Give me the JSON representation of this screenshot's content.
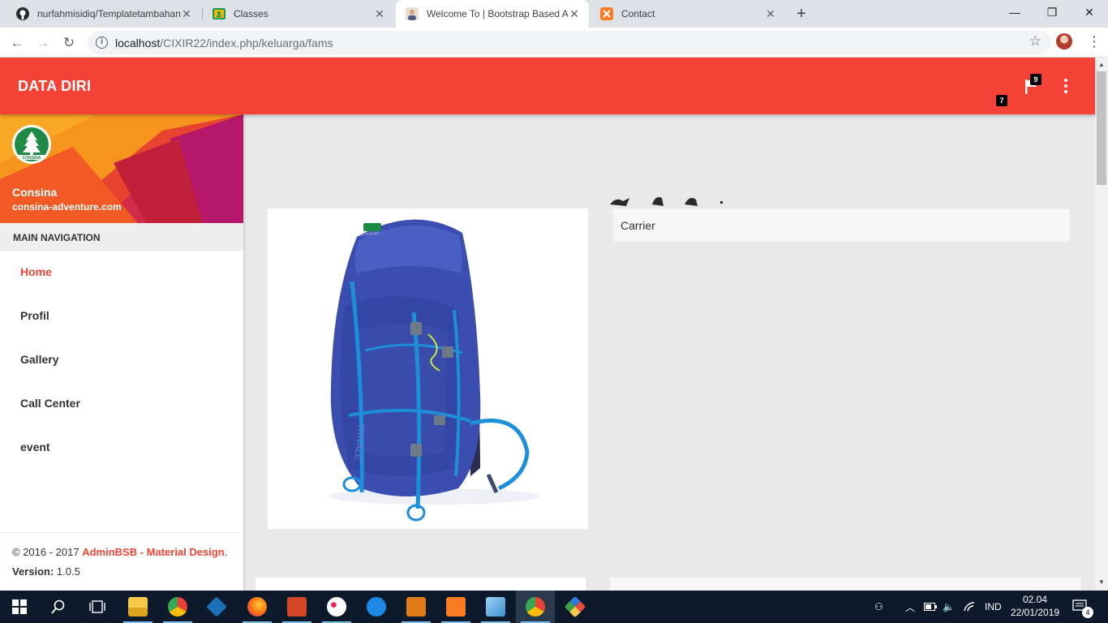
{
  "browser": {
    "tabs": [
      {
        "title": "nurfahmisidiq/Templatetambahan",
        "icon": "github-icon",
        "active": false
      },
      {
        "title": "Classes",
        "icon": "google-classroom-icon",
        "active": false
      },
      {
        "title": "Welcome To | Bootstrap Based Admin",
        "icon": "avatar-icon",
        "active": true
      },
      {
        "title": "Contact",
        "icon": "xampp-icon",
        "active": false
      }
    ],
    "url_host": "localhost",
    "url_path": "/CIXIR22/index.php/keluarga/fams"
  },
  "app": {
    "title": "DATA DIRI",
    "accent_color": "#f44336",
    "notifications": {
      "flag_count": "9",
      "secondary_count": "7"
    }
  },
  "sidebar": {
    "user_name": "Consina",
    "user_email": "consina-adventure.com",
    "logo_text": "CONSINA",
    "nav_header": "MAIN NAVIGATION",
    "items": [
      {
        "label": "Home",
        "active": true
      },
      {
        "label": "Profil",
        "active": false
      },
      {
        "label": "Gallery",
        "active": false
      },
      {
        "label": "Call Center",
        "active": false
      },
      {
        "label": "event",
        "active": false
      }
    ],
    "footer": {
      "copyright": "© 2016 - 2017 ",
      "brand": "AdminBSB - Material Design",
      "period": ".",
      "version_label": "Version: ",
      "version": "1.0.5"
    }
  },
  "content": {
    "product_title": "Carrier",
    "product_image": "blue-backpack-image"
  },
  "taskbar": {
    "language": "IND",
    "time": "02.04",
    "date": "22/01/2019",
    "notification_count": "4"
  }
}
